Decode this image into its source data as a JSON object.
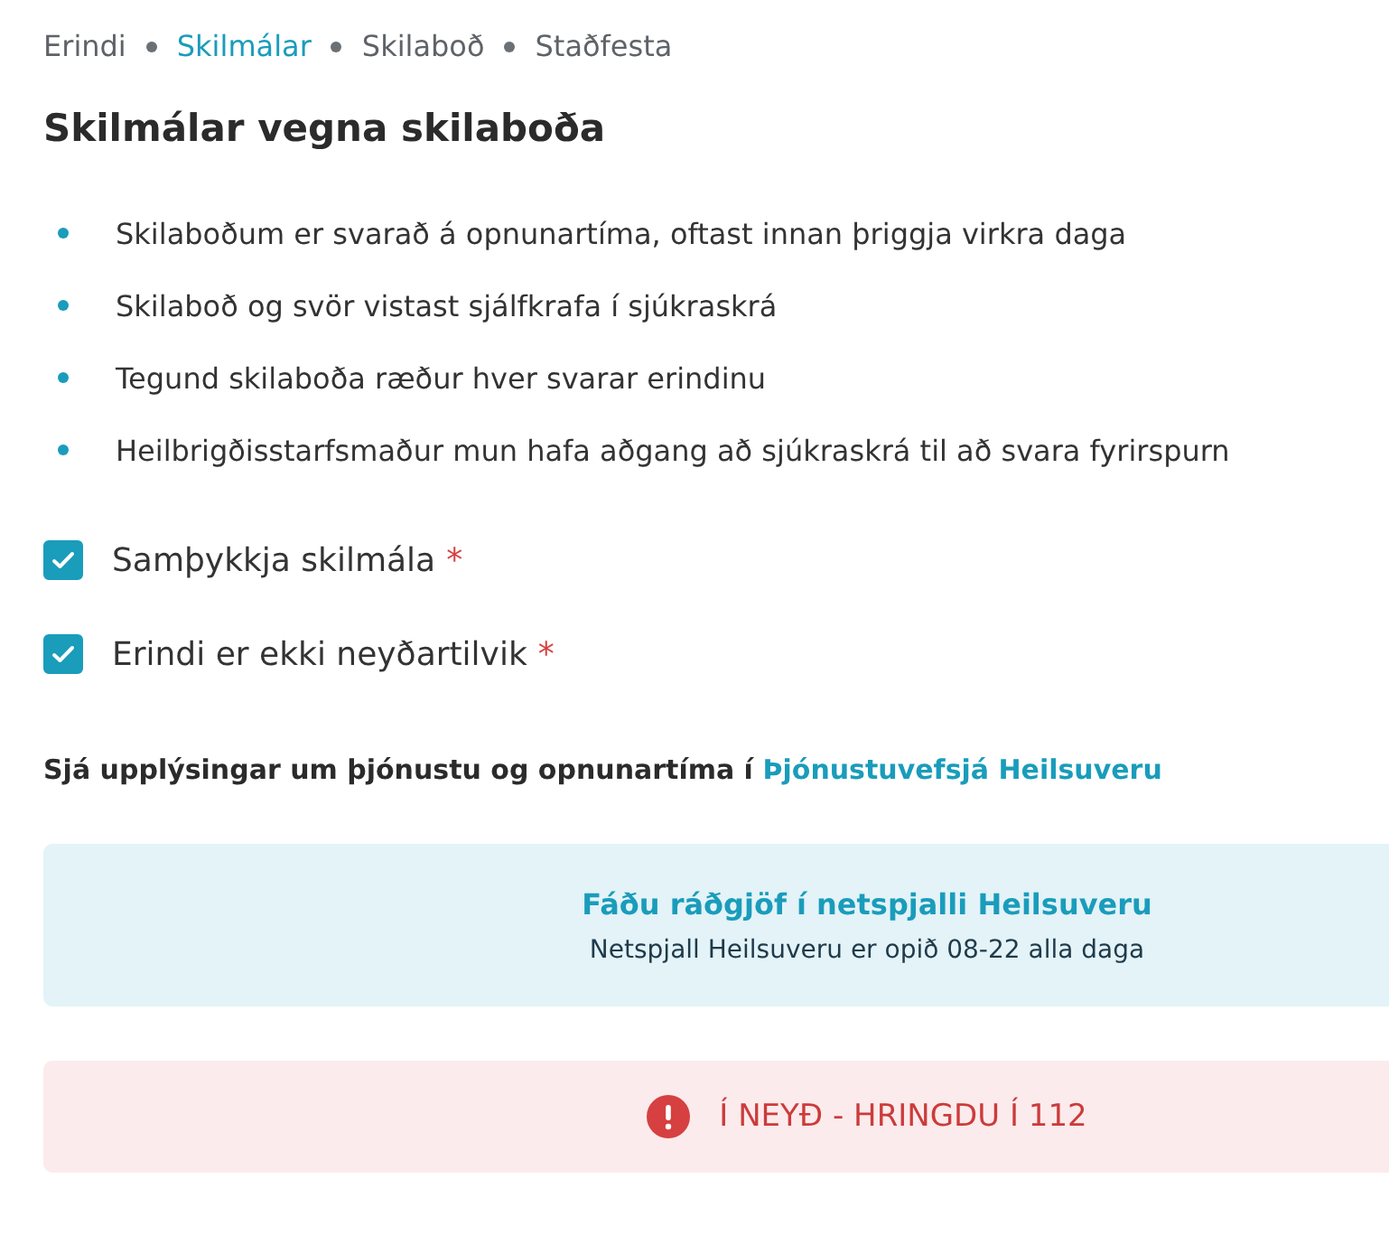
{
  "steps": [
    {
      "label": "Erindi",
      "selected": false
    },
    {
      "label": "Skilmálar",
      "selected": true
    },
    {
      "label": "Skilaboð",
      "selected": false
    },
    {
      "label": "Staðfesta",
      "selected": false
    }
  ],
  "heading": "Skilmálar vegna skilaboða",
  "terms": [
    "Skilaboðum er svarað á opnunartíma, oftast innan þriggja virkra daga",
    "Skilaboð og svör vistast sjálfkrafa í sjúkraskrá",
    "Tegund skilaboða ræður hver svarar erindinu",
    "Heilbrigðisstarfsmaður mun hafa aðgang að sjúkraskrá til að svara fyrirspurn"
  ],
  "checkboxes": [
    {
      "label": "Samþykkja skilmála",
      "checked": true,
      "required_mark": "*"
    },
    {
      "label": "Erindi er ekki neyðartilvik",
      "checked": true,
      "required_mark": "*"
    }
  ],
  "info": {
    "text": "Sjá upplýsingar um þjónustu og opnunartíma í",
    "link": "Þjónustuvefsjá Heilsuveru"
  },
  "chat_panel": {
    "title": "Fáðu ráðgjöf í netspjalli Heilsuveru",
    "subtitle": "Netspjall Heilsuveru er opið 08-22 alla daga"
  },
  "emergency_panel": {
    "text": "Í NEYÐ - HRINGDU Í 112"
  }
}
